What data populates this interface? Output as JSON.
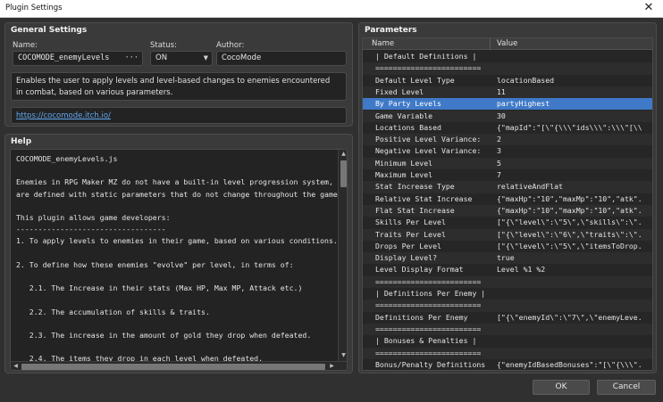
{
  "window": {
    "title": "Plugin Settings"
  },
  "general": {
    "title": "General Settings",
    "name_label": "Name:",
    "name_value": "COCOMODE_enemyLevels",
    "name_dots": "···",
    "status_label": "Status:",
    "status_value": "ON",
    "author_label": "Author:",
    "author_value": "CocoMode",
    "description_lines": [
      "Enables the user to apply levels and level-based changes to enemies encountered",
      "in combat, based on various parameters."
    ],
    "url": "https://cocomode.itch.io/"
  },
  "help": {
    "title": "Help",
    "lines": [
      "COCOMODE_enemyLevels.js",
      "",
      "Enemies in RPG Maker MZ do not have a built-in level progression system, and",
      "are defined with static parameters that do not change throughout the game.",
      "",
      "This plugin allows game developers:",
      "----------------------------------",
      "1. To apply levels to enemies in their game, based on various conditions.",
      "",
      "2. To define how these enemies \"evolve\" per level, in terms of:",
      "",
      "   2.1. The Increase in their stats (Max HP, Max MP, Attack etc.)",
      "",
      "   2.2. The accumulation of skills & traits.",
      "",
      "   2.3. The increase in the amount of gold they drop when defeated.",
      "",
      "   2.4. The items they drop in each level when defeated."
    ]
  },
  "parameters": {
    "title": "Parameters",
    "col_name": "Name",
    "col_value": "Value",
    "rows": [
      {
        "name": "|  Default Definitions   |",
        "value": ""
      },
      {
        "name": "========================",
        "value": ""
      },
      {
        "name": "Default Level Type",
        "value": "locationBased"
      },
      {
        "name": "Fixed Level",
        "value": "11"
      },
      {
        "name": "By Party Levels",
        "value": "partyHighest"
      },
      {
        "name": "Game Variable",
        "value": "30"
      },
      {
        "name": "Locations Based",
        "value": "{\"mapId\":\"[\\\"{\\\\\\\"ids\\\\\\\":\\\\\\\"[\\\\\\\\..."
      },
      {
        "name": "Positive Level Variance:",
        "value": "2"
      },
      {
        "name": "Negative Level Variance:",
        "value": "3"
      },
      {
        "name": "Minimum Level",
        "value": "5"
      },
      {
        "name": "Maximum Level",
        "value": "7"
      },
      {
        "name": "Stat Increase Type",
        "value": "relativeAndFlat"
      },
      {
        "name": "Relative Stat Increase",
        "value": "{\"maxHp\":\"10\",\"maxMp\":\"10\",\"atk\"..."
      },
      {
        "name": "Flat Stat Increase",
        "value": "{\"maxHp\":\"10\",\"maxMp\":\"10\",\"atk\"..."
      },
      {
        "name": "Skills Per Level",
        "value": "[\"{\\\"level\\\":\\\"5\\\",\\\"skills\\\":\\\"..."
      },
      {
        "name": "Traits Per Level",
        "value": "[\"{\\\"level\\\":\\\"6\\\",\\\"traits\\\":\\\"..."
      },
      {
        "name": "Drops Per Level",
        "value": "[\"{\\\"level\\\":\\\"5\\\",\\\"itemsToDrop..."
      },
      {
        "name": "Display Level?",
        "value": "true"
      },
      {
        "name": "Level Display Format",
        "value": "Level %1 %2"
      },
      {
        "name": "========================",
        "value": ""
      },
      {
        "name": "| Definitions Per Enemy  |",
        "value": ""
      },
      {
        "name": "========================",
        "value": ""
      },
      {
        "name": "Definitions Per Enemy",
        "value": "[\"{\\\"enemyId\\\":\\\"7\\\",\\\"enemyLeve..."
      },
      {
        "name": "========================",
        "value": ""
      },
      {
        "name": "|  Bonuses & Penalties   |",
        "value": ""
      },
      {
        "name": "========================",
        "value": ""
      },
      {
        "name": "Bonus/Penalty Definitions",
        "value": "{\"enemyIdBasedBonuses\":\"[\\\"{\\\\\\\"..."
      }
    ],
    "selected_index": 4
  },
  "buttons": {
    "ok": "OK",
    "cancel": "Cancel"
  },
  "colors": {
    "selection": "#3f79c8",
    "link": "#5fa8f0",
    "background": "#303030"
  }
}
